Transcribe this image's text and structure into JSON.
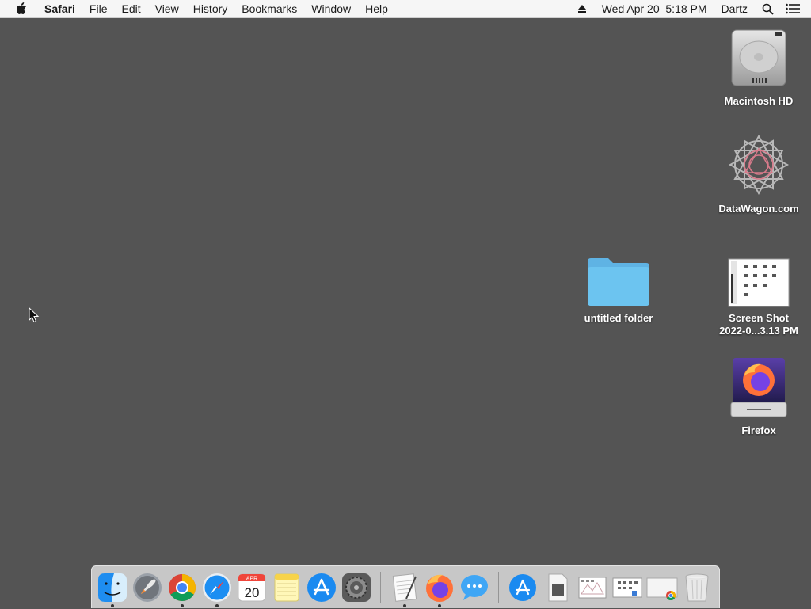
{
  "menubar": {
    "app_name": "Safari",
    "menus": [
      "File",
      "Edit",
      "View",
      "History",
      "Bookmarks",
      "Window",
      "Help"
    ],
    "datetime": "Wed Apr 20  5:18 PM",
    "user": "Dartz"
  },
  "desktop": {
    "icons": [
      {
        "label": "Macintosh HD",
        "icon": "hard-drive-icon"
      },
      {
        "label": "DataWagon.com",
        "icon": "network-volume-icon"
      },
      {
        "label": "untitled folder",
        "icon": "folder-icon"
      },
      {
        "label": "Screen Shot\n2022-0...3.13 PM",
        "icon": "screenshot-file-icon"
      },
      {
        "label": "Firefox",
        "icon": "firefox-disk-image-icon"
      }
    ]
  },
  "dock": {
    "items": [
      {
        "name": "Finder",
        "icon": "finder-icon",
        "running": true
      },
      {
        "name": "Launchpad",
        "icon": "launchpad-icon",
        "running": false
      },
      {
        "name": "Google Chrome",
        "icon": "chrome-icon",
        "running": true
      },
      {
        "name": "Safari",
        "icon": "safari-icon",
        "running": true
      },
      {
        "name": "Calendar",
        "icon": "calendar-icon",
        "running": false,
        "month": "APR",
        "day": "20"
      },
      {
        "name": "Notes",
        "icon": "notes-icon",
        "running": false
      },
      {
        "name": "App Store",
        "icon": "app-store-icon",
        "running": false
      },
      {
        "name": "System Preferences",
        "icon": "system-preferences-icon",
        "running": false
      },
      {
        "name": "TextEdit",
        "icon": "textedit-icon",
        "running": true
      },
      {
        "name": "Firefox",
        "icon": "firefox-icon",
        "running": true
      },
      {
        "name": "Messages",
        "icon": "messages-icon",
        "running": false
      },
      {
        "name": "Applications",
        "icon": "applications-folder-icon",
        "running": false
      },
      {
        "name": "Document",
        "icon": "document-stack-icon",
        "running": false
      },
      {
        "name": "Screenshot",
        "icon": "screenshot-stack-icon",
        "running": false
      },
      {
        "name": "Screenshot",
        "icon": "screenshot-stack-icon-2",
        "running": false
      },
      {
        "name": "Chrome file",
        "icon": "chrome-file-icon",
        "running": false
      },
      {
        "name": "Trash",
        "icon": "trash-icon",
        "running": false
      }
    ]
  },
  "colors": {
    "desktop": "#545454",
    "menubar": "#f6f6f6",
    "folder": "#6cc4f0",
    "firefox_orange": "#ff7139",
    "firefox_purple": "#7542e5"
  }
}
